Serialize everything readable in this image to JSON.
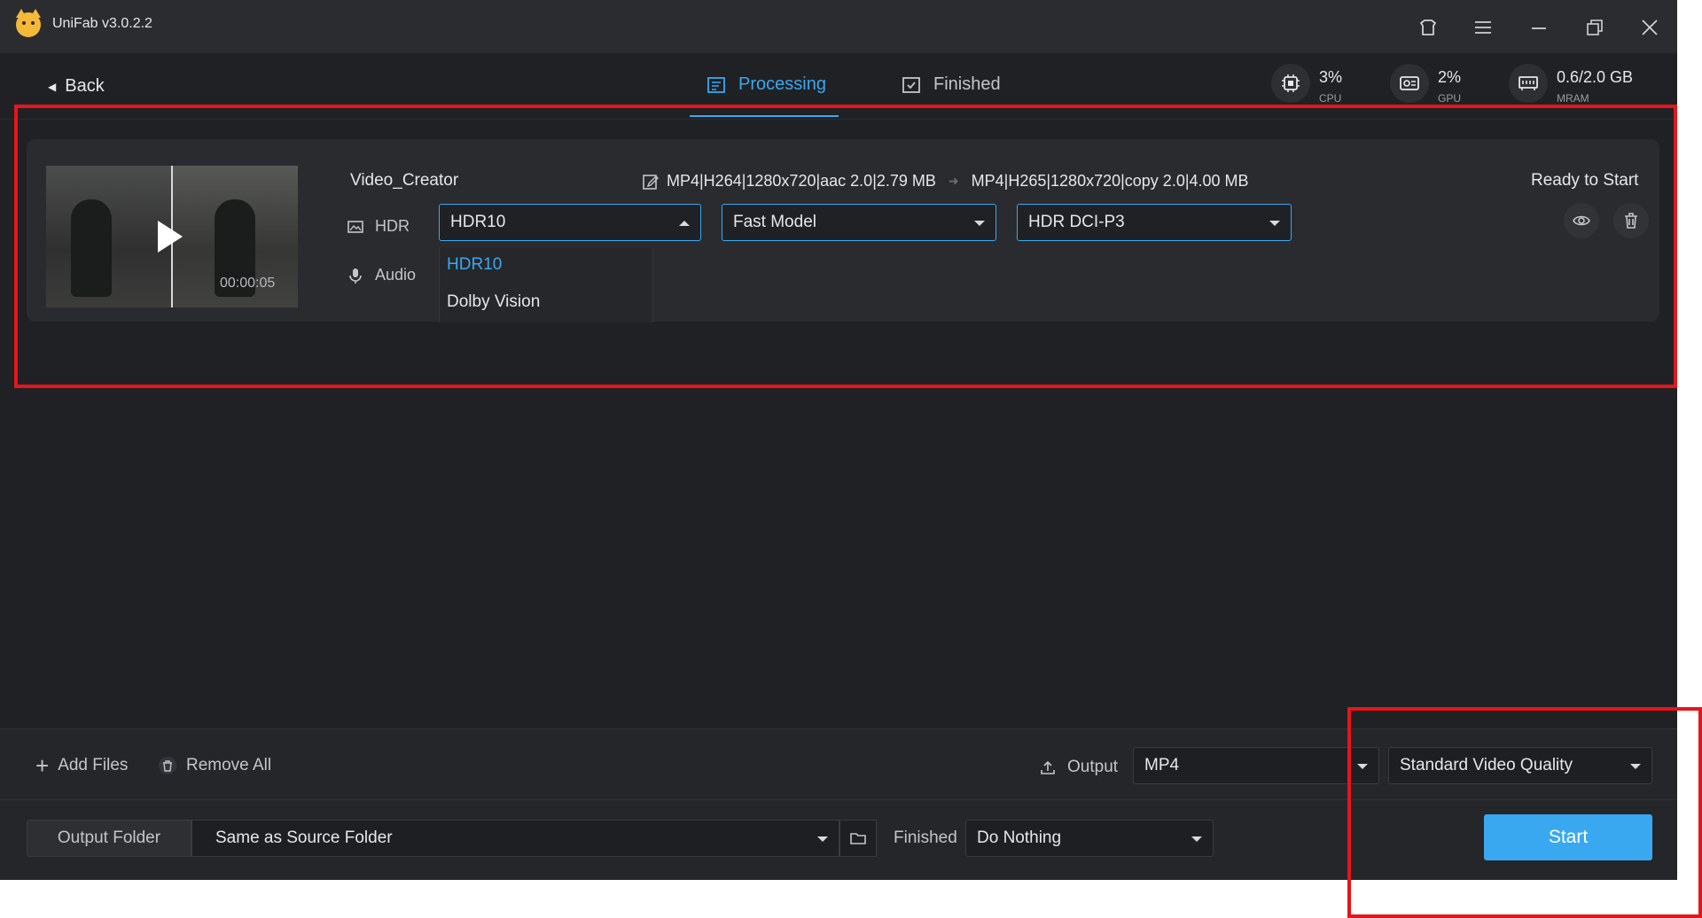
{
  "app": {
    "title": "UniFab v3.0.2.2"
  },
  "nav": {
    "back_label": "Back",
    "tabs": [
      {
        "label": "Processing",
        "active": true
      },
      {
        "label": "Finished",
        "active": false
      }
    ]
  },
  "stats": [
    {
      "value": "3%",
      "label": "CPU",
      "icon": "cpu-icon"
    },
    {
      "value": "2%",
      "label": "GPU",
      "icon": "gpu-icon"
    },
    {
      "value": "0.6/2.0 GB",
      "label": "MRAM",
      "icon": "memory-icon"
    }
  ],
  "task": {
    "name": "Video_Creator",
    "duration": "00:00:05",
    "source_info": "MP4|H264|1280x720|aac 2.0|2.79 MB",
    "target_info": "MP4|H265|1280x720|copy 2.0|4.00 MB",
    "status": "Ready to Start",
    "hdr_label": "HDR",
    "audio_label": "Audio",
    "hdr_select": "HDR10",
    "model_select": "Fast Model",
    "color_select": "HDR DCI-P3",
    "hdr_options": [
      "HDR10",
      "Dolby Vision"
    ]
  },
  "bottom": {
    "add_files": "Add Files",
    "remove_all": "Remove All",
    "output_label": "Output",
    "output_format": "MP4",
    "quality": "Standard Video Quality",
    "output_folder_label": "Output Folder",
    "output_folder_value": "Same as Source Folder",
    "finished_label": "Finished",
    "finished_action": "Do Nothing",
    "start": "Start"
  },
  "colors": {
    "accent": "#3aa8f0",
    "highlight": "#e8141b",
    "background": "#202124"
  }
}
